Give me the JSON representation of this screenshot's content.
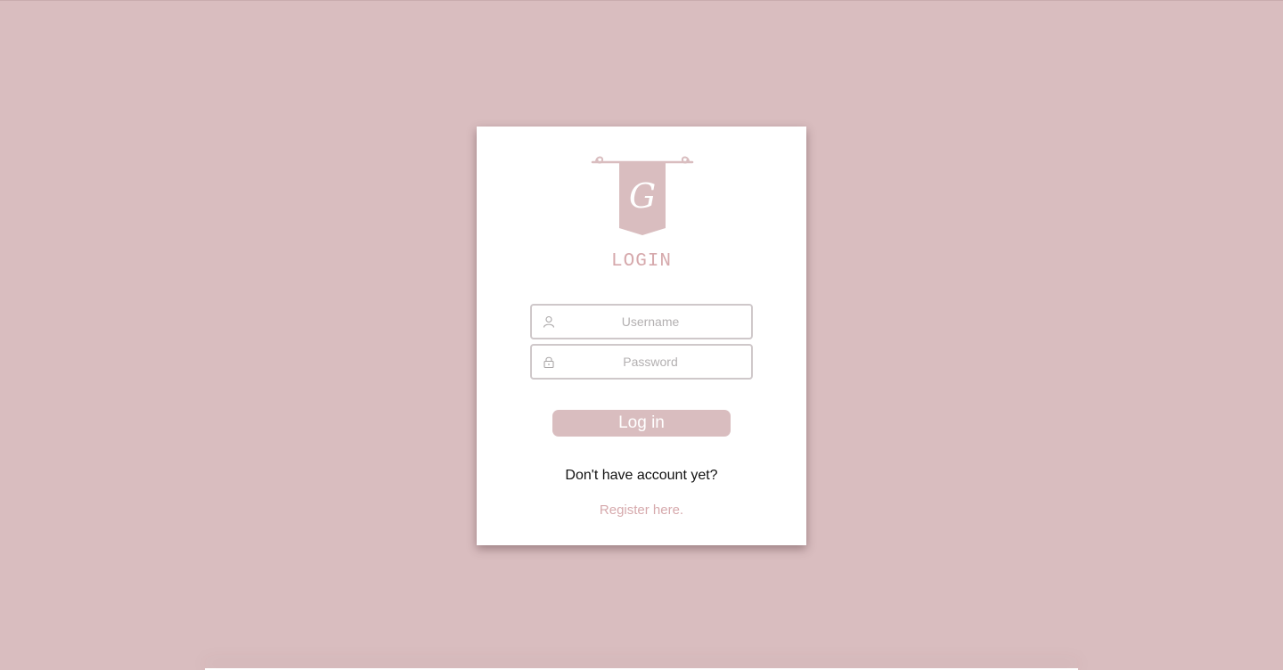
{
  "login_card": {
    "title": "LOGIN",
    "logo_letter": "G",
    "username": {
      "placeholder": "Username",
      "value": "",
      "icon": "user-icon"
    },
    "password": {
      "placeholder": "Password",
      "value": "",
      "icon": "lock-icon"
    },
    "login_button_label": "Log in",
    "no_account_text": "Don't have account yet?",
    "register_link_text": "Register here."
  },
  "colors": {
    "background": "#d9bdbf",
    "accent": "#d6a9ac",
    "card": "#ffffff"
  }
}
